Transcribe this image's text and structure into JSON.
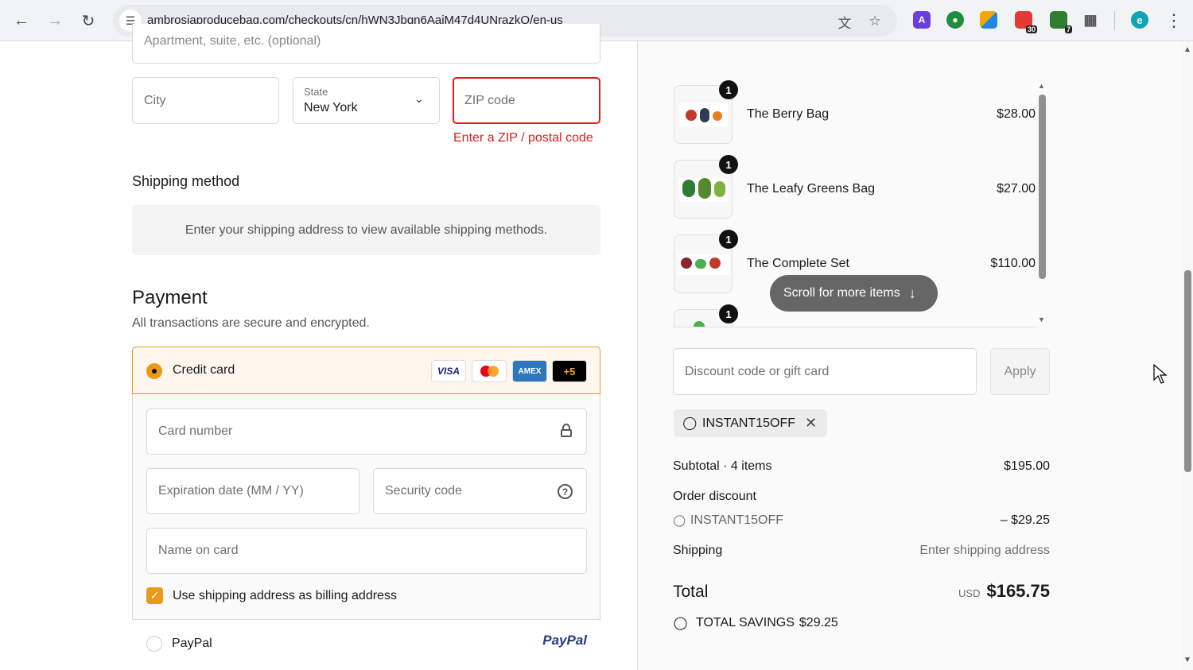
{
  "browser": {
    "url": "ambrosiaproducebag.com/checkouts/cn/hWN3Jbqn6AajM47d4UNrazkQ/en-us",
    "icons": [
      "back-icon",
      "forward-icon",
      "reload-icon",
      "site-info-icon",
      "translate-icon",
      "bookmark-star-icon"
    ],
    "extensions": [
      {
        "name": "ext-a",
        "label": "A",
        "color": "#6c3fdc"
      },
      {
        "name": "ext-green-circle",
        "label": "",
        "color": "#1e8e3e"
      },
      {
        "name": "ext-grid",
        "label": "",
        "color": "#f2a600"
      },
      {
        "name": "ext-red",
        "label": "",
        "color": "#e53935",
        "badge": "30"
      },
      {
        "name": "ext-green",
        "label": "",
        "color": "#2e7d32",
        "badge": "7"
      }
    ],
    "profile_initial": "e"
  },
  "address": {
    "apartment_placeholder": "Apartment, suite, etc. (optional)",
    "city_placeholder": "City",
    "state_label": "State",
    "state_value": "New York",
    "zip_placeholder": "ZIP code",
    "zip_error": "Enter a ZIP / postal code",
    "error_color": "#dd1d1d"
  },
  "shipping": {
    "heading": "Shipping method",
    "notice": "Enter your shipping address to view available shipping methods."
  },
  "payment": {
    "heading": "Payment",
    "subheading": "All transactions are secure and encrypted.",
    "credit_card_label": "Credit card",
    "card_brands": [
      "VISA",
      "",
      "AMEX",
      "+5"
    ],
    "card_number_placeholder": "Card number",
    "expiry_placeholder": "Expiration date (MM / YY)",
    "security_placeholder": "Security code",
    "name_placeholder": "Name on card",
    "billing_checkbox_label": "Use shipping address as billing address",
    "paypal_label": "PayPal",
    "paypal_logo": "PayPal",
    "accent_color": "#e89a18"
  },
  "cart": {
    "items": [
      {
        "name": "The Berry Bag",
        "price": "$28.00",
        "qty": "1"
      },
      {
        "name": "The Leafy Greens Bag",
        "price": "$27.00",
        "qty": "1"
      },
      {
        "name": "The Complete Set",
        "price": "$110.00",
        "qty": "1"
      },
      {
        "name": "",
        "price": "",
        "qty": "1"
      }
    ],
    "scroll_hint": "Scroll for more items",
    "discount_placeholder": "Discount code or gift card",
    "apply_label": "Apply",
    "applied_code": "INSTANT15OFF"
  },
  "summary": {
    "subtotal_label": "Subtotal · 4 items",
    "subtotal_value": "$195.00",
    "order_discount_label": "Order discount",
    "discount_code": "INSTANT15OFF",
    "discount_value": "– $29.25",
    "shipping_label": "Shipping",
    "shipping_value": "Enter shipping address",
    "total_label": "Total",
    "currency": "USD",
    "total_value": "$165.75",
    "savings_label": "TOTAL SAVINGS",
    "savings_value": "$29.25"
  }
}
